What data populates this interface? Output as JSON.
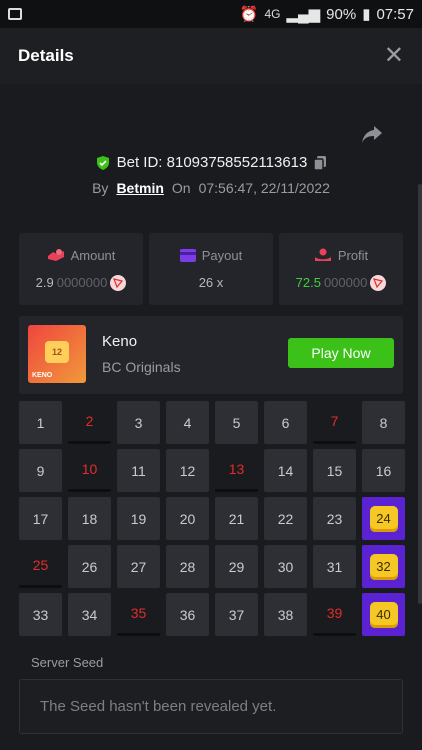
{
  "status": {
    "battery": "90%",
    "time": "07:57",
    "network": "4G"
  },
  "header": {
    "title": "Details",
    "close_icon": "close-icon"
  },
  "bet": {
    "id_label": "Bet ID: 81093758552113613",
    "by_label": "By",
    "user": "Betmin",
    "on_label": "On",
    "datetime": "07:56:47, 22/11/2022"
  },
  "stats": {
    "amount": {
      "label": "Amount",
      "value_main": "2.9",
      "value_dim": "0000000"
    },
    "payout": {
      "label": "Payout",
      "value": "26 x"
    },
    "profit": {
      "label": "Profit",
      "value_main": "72.5",
      "value_dim": "000000"
    }
  },
  "game": {
    "name": "Keno",
    "provider": "BC Originals",
    "play_label": "Play Now",
    "thumb_number": "12",
    "thumb_label": "KENO"
  },
  "numbers": [
    {
      "n": "1",
      "state": "normal"
    },
    {
      "n": "2",
      "state": "miss"
    },
    {
      "n": "3",
      "state": "normal"
    },
    {
      "n": "4",
      "state": "normal"
    },
    {
      "n": "5",
      "state": "normal"
    },
    {
      "n": "6",
      "state": "normal"
    },
    {
      "n": "7",
      "state": "miss"
    },
    {
      "n": "8",
      "state": "normal"
    },
    {
      "n": "9",
      "state": "normal"
    },
    {
      "n": "10",
      "state": "miss"
    },
    {
      "n": "11",
      "state": "normal"
    },
    {
      "n": "12",
      "state": "normal"
    },
    {
      "n": "13",
      "state": "miss"
    },
    {
      "n": "14",
      "state": "normal"
    },
    {
      "n": "15",
      "state": "normal"
    },
    {
      "n": "16",
      "state": "normal"
    },
    {
      "n": "17",
      "state": "normal"
    },
    {
      "n": "18",
      "state": "normal"
    },
    {
      "n": "19",
      "state": "normal"
    },
    {
      "n": "20",
      "state": "normal"
    },
    {
      "n": "21",
      "state": "normal"
    },
    {
      "n": "22",
      "state": "normal"
    },
    {
      "n": "23",
      "state": "normal"
    },
    {
      "n": "24",
      "state": "hit"
    },
    {
      "n": "25",
      "state": "miss"
    },
    {
      "n": "26",
      "state": "normal"
    },
    {
      "n": "27",
      "state": "normal"
    },
    {
      "n": "28",
      "state": "normal"
    },
    {
      "n": "29",
      "state": "normal"
    },
    {
      "n": "30",
      "state": "normal"
    },
    {
      "n": "31",
      "state": "normal"
    },
    {
      "n": "32",
      "state": "hit"
    },
    {
      "n": "33",
      "state": "normal"
    },
    {
      "n": "34",
      "state": "normal"
    },
    {
      "n": "35",
      "state": "miss"
    },
    {
      "n": "36",
      "state": "normal"
    },
    {
      "n": "37",
      "state": "normal"
    },
    {
      "n": "38",
      "state": "normal"
    },
    {
      "n": "39",
      "state": "miss"
    },
    {
      "n": "40",
      "state": "hit"
    }
  ],
  "seed": {
    "label": "Server Seed",
    "placeholder": "The Seed hasn't been revealed yet."
  },
  "colors": {
    "accent_green": "#3bc117",
    "hit_purple": "#5a22d0",
    "miss_red": "#e02d2d",
    "gem_yellow": "#f5c823"
  }
}
